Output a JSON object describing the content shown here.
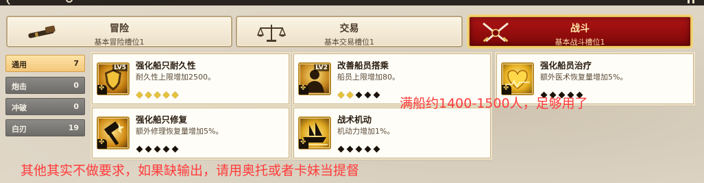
{
  "tabs": [
    {
      "name": "冒险",
      "sub": "基本冒险槽位1",
      "icon": "spyglass-icon"
    },
    {
      "name": "交易",
      "sub": "基本交易槽位1",
      "icon": "scales-icon"
    },
    {
      "name": "战斗",
      "sub": "基本战斗槽位1",
      "icon": "crossed-swords-icon",
      "active": true
    }
  ],
  "filters": [
    {
      "label": "通用",
      "count": "7",
      "active": true
    },
    {
      "label": "炮击",
      "count": "0"
    },
    {
      "label": "冲破",
      "count": "0"
    },
    {
      "label": "白刃",
      "count": "19"
    }
  ],
  "cards": [
    {
      "name": "强化船只耐久性",
      "desc": "耐久性上限增加2500。",
      "level": "LV5",
      "icon": "shield-icon",
      "stars_filled": 5
    },
    {
      "name": "改善船员搭乘",
      "desc": "船员上限增加80。",
      "level": "LV2",
      "icon": "crew-icon",
      "stars_filled": 2
    },
    {
      "name": "强化船员治疗",
      "desc": "额外医术恢复量增加5%。",
      "level": "",
      "icon": "heart-icon",
      "stars_filled": 0
    },
    {
      "name": "强化船只修复",
      "desc": "额外修理恢复量增加5%。",
      "level": "",
      "icon": "hammer-icon",
      "stars_filled": 0
    },
    {
      "name": "战术机动",
      "desc": "机动力增加1%。",
      "level": "",
      "icon": "ship-icon",
      "stars_filled": 0
    }
  ],
  "notes": {
    "crew_note": "满船约1400-1500人，足够用了",
    "bottom_note": "其他其实不做要求，如果缺输出，请用奥托或者卡妹当提督"
  }
}
